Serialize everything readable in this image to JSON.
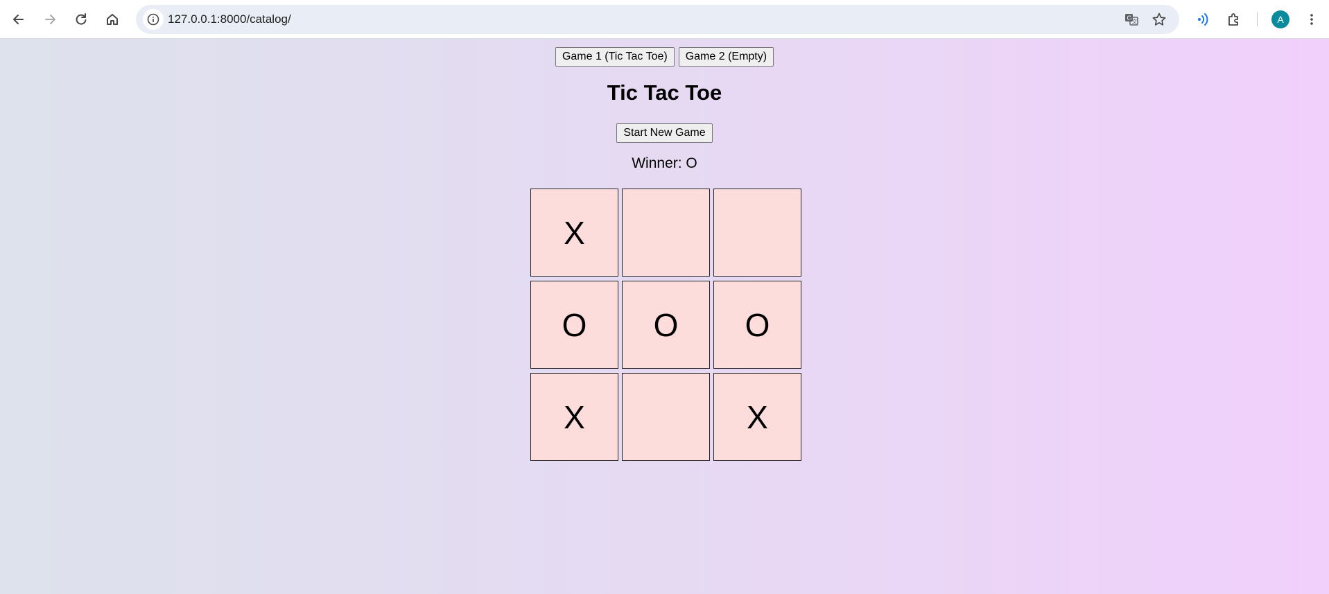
{
  "browser": {
    "url": "127.0.0.1:8000/catalog/",
    "avatar_letter": "A"
  },
  "nav": {
    "game1_label": "Game 1 (Tic Tac Toe)",
    "game2_label": "Game 2 (Empty)"
  },
  "game": {
    "title": "Tic Tac Toe",
    "start_label": "Start New Game",
    "status": "Winner: O",
    "board": [
      "X",
      "",
      "",
      "O",
      "O",
      "O",
      "X",
      "",
      "X"
    ]
  },
  "colors": {
    "cell_bg": "#fddcdc",
    "avatar_bg": "#0a8a9c",
    "gradient_left": "#dde2ec",
    "gradient_right": "#f1d0fb"
  },
  "icons": [
    "back-icon",
    "forward-icon",
    "reload-icon",
    "home-icon",
    "site-info-icon",
    "translate-icon",
    "bookmark-star-icon",
    "media-cast-icon",
    "extensions-icon",
    "menu-kebab-icon"
  ]
}
